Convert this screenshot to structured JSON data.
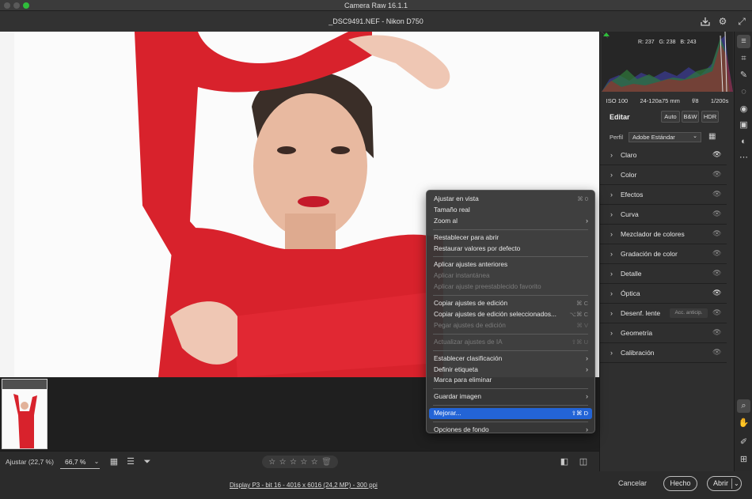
{
  "window": {
    "title": "Camera Raw 16.1.1"
  },
  "header": {
    "file_title": "_DSC9491.NEF -  Nikon D750"
  },
  "histogram": {
    "r": "R: 237",
    "g": "G: 238",
    "b": "B: 243"
  },
  "exif": {
    "iso": "ISO 100",
    "lens": "24-120a75 mm",
    "aperture": "f/8",
    "shutter": "1/200s"
  },
  "edit": {
    "title": "Editar",
    "auto": "Auto",
    "bw": "B&W",
    "hdr": "HDR",
    "profile_label": "Perfil",
    "profile_value": "Adobe Estándar"
  },
  "sections": [
    {
      "label": "Claro",
      "eye_on": true
    },
    {
      "label": "Color",
      "eye_on": false
    },
    {
      "label": "Efectos",
      "eye_on": false
    },
    {
      "label": "Curva",
      "eye_on": false
    },
    {
      "label": "Mezclador de colores",
      "eye_on": false
    },
    {
      "label": "Gradación de color",
      "eye_on": false
    },
    {
      "label": "Detalle",
      "eye_on": false
    },
    {
      "label": "Óptica",
      "eye_on": true
    },
    {
      "label": "Desenf. lente",
      "eye_on": false,
      "tag": "Acc. anticip."
    },
    {
      "label": "Geometría",
      "eye_on": false
    },
    {
      "label": "Calibración",
      "eye_on": false
    }
  ],
  "bottombar": {
    "fit_label": "Ajustar (22,7 %)",
    "zoom_value": "66,7 %"
  },
  "footer": {
    "meta_link": "Display P3 - bit 16 - 4016 x 6016 (24,2 MP) - 300 ppi",
    "cancel": "Cancelar",
    "done": "Hecho",
    "open": "Abrir"
  },
  "menu": {
    "groups": [
      [
        {
          "label": "Ajustar en vista",
          "shortcut": "⌘ 0",
          "disabled": false
        },
        {
          "label": "Tamaño real",
          "shortcut": "",
          "disabled": false
        },
        {
          "label": "Zoom al",
          "shortcut": "›",
          "disabled": false,
          "submenu": true
        }
      ],
      [
        {
          "label": "Restablecer para abrir",
          "shortcut": "",
          "disabled": false
        },
        {
          "label": "Restaurar valores por defecto",
          "shortcut": "",
          "disabled": false
        }
      ],
      [
        {
          "label": "Aplicar ajustes anteriores",
          "shortcut": "",
          "disabled": false
        },
        {
          "label": "Aplicar instantánea",
          "shortcut": "",
          "disabled": true
        },
        {
          "label": "Aplicar ajuste preestablecido favorito",
          "shortcut": "",
          "disabled": true
        }
      ],
      [
        {
          "label": "Copiar ajustes de edición",
          "shortcut": "⌘ C",
          "disabled": false
        },
        {
          "label": "Copiar ajustes de edición seleccionados...",
          "shortcut": "⌥⌘ C",
          "disabled": false
        },
        {
          "label": "Pegar ajustes de edición",
          "shortcut": "⌘ V",
          "disabled": true
        }
      ],
      [
        {
          "label": "Actualizar ajustes de IA",
          "shortcut": "⇧⌘ U",
          "disabled": true
        }
      ],
      [
        {
          "label": "Establecer clasificación",
          "shortcut": "›",
          "disabled": false,
          "submenu": true
        },
        {
          "label": "Definir etiqueta",
          "shortcut": "›",
          "disabled": false,
          "submenu": true
        },
        {
          "label": "Marca para eliminar",
          "shortcut": "",
          "disabled": false
        }
      ],
      [
        {
          "label": "Guardar imagen",
          "shortcut": "›",
          "disabled": false,
          "submenu": true
        }
      ],
      [
        {
          "label": "Mejorar...",
          "shortcut": "⇧⌘ D",
          "disabled": false,
          "highlighted": true
        }
      ],
      [
        {
          "label": "Opciones de fondo",
          "shortcut": "›",
          "disabled": false,
          "submenu": true
        }
      ]
    ]
  }
}
